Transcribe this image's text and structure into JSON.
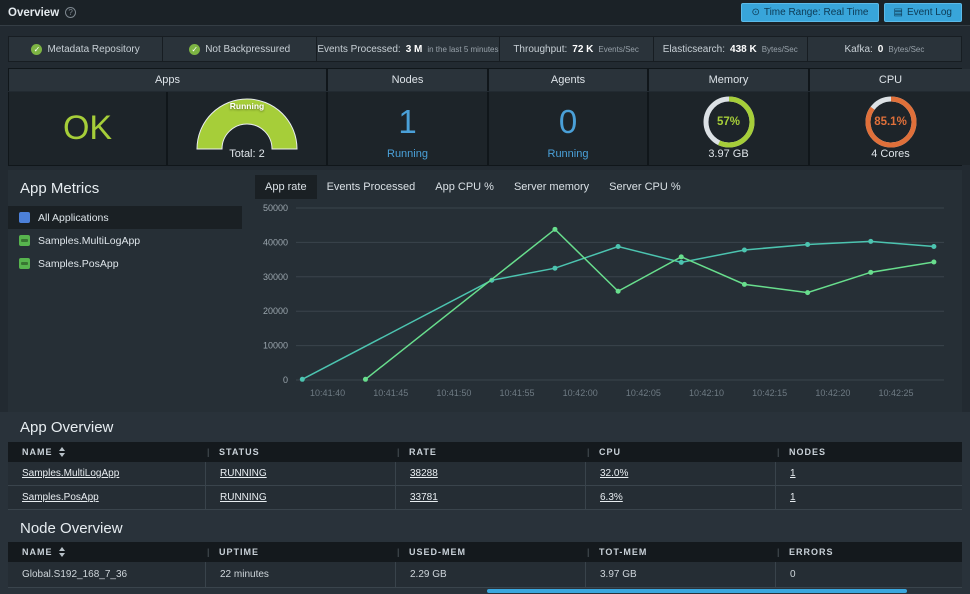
{
  "topbar": {
    "title": "Overview",
    "time_range_button": "Time Range: Real Time",
    "event_log_button": "Event Log"
  },
  "status_bar": [
    {
      "icon": "check",
      "label": "Metadata Repository",
      "value": "",
      "suffix": ""
    },
    {
      "icon": "check",
      "label": "Not Backpressured",
      "value": "",
      "suffix": ""
    },
    {
      "icon": "",
      "label": "Events Processed:",
      "value": "3 M",
      "suffix": "in the last 5 minutes"
    },
    {
      "icon": "",
      "label": "Throughput:",
      "value": "72 K",
      "suffix": "Events/Sec"
    },
    {
      "icon": "",
      "label": "Elasticsearch:",
      "value": "438 K",
      "suffix": "Bytes/Sec"
    },
    {
      "icon": "",
      "label": "Kafka:",
      "value": "0",
      "suffix": "Bytes/Sec"
    }
  ],
  "summary": {
    "headers": [
      "Apps",
      "Nodes",
      "Agents",
      "Memory",
      "CPU"
    ],
    "apps": {
      "status_text": "OK",
      "gauge_label": "Running",
      "total_label": "Total: 2",
      "gauge_color": "#a6ce39"
    },
    "nodes": {
      "value": "1",
      "sub": "Running"
    },
    "agents": {
      "value": "0",
      "sub": "Running"
    },
    "memory": {
      "percent": 57,
      "percent_label": "57%",
      "sub": "3.97 GB",
      "color": "#a6ce39"
    },
    "cpu": {
      "percent": 85.1,
      "percent_label": "85.1%",
      "sub": "4 Cores",
      "color": "#e0703a"
    }
  },
  "app_metrics": {
    "title": "App Metrics",
    "tabs": [
      {
        "label": "App rate",
        "active": true
      },
      {
        "label": "Events Processed",
        "active": false
      },
      {
        "label": "App CPU %",
        "active": false
      },
      {
        "label": "Server memory",
        "active": false
      },
      {
        "label": "Server CPU %",
        "active": false
      }
    ],
    "legend": [
      {
        "label": "All Applications",
        "color": "#4c80d8",
        "selected": true,
        "kind": "all"
      },
      {
        "label": "Samples.MultiLogApp",
        "color": "#57b44e",
        "selected": false,
        "kind": "app"
      },
      {
        "label": "Samples.PosApp",
        "color": "#57b44e",
        "selected": false,
        "kind": "app"
      }
    ]
  },
  "chart_data": {
    "type": "line",
    "title": "App rate",
    "xlabel": "",
    "ylabel": "",
    "ylim": [
      0,
      50000
    ],
    "yticks": [
      0,
      10000,
      20000,
      30000,
      40000,
      50000
    ],
    "grid": true,
    "legend_position": "left",
    "xlim_seconds": [
      37.5,
      88.8
    ],
    "xticks": [
      {
        "t": 40,
        "label": "10:41:40"
      },
      {
        "t": 45,
        "label": "10:41:45"
      },
      {
        "t": 50,
        "label": "10:41:50"
      },
      {
        "t": 55,
        "label": "10:41:55"
      },
      {
        "t": 60,
        "label": "10:42:00"
      },
      {
        "t": 65,
        "label": "10:42:05"
      },
      {
        "t": 70,
        "label": "10:42:10"
      },
      {
        "t": 75,
        "label": "10:42:15"
      },
      {
        "t": 80,
        "label": "10:42:20"
      },
      {
        "t": 85,
        "label": "10:42:25"
      }
    ],
    "series": [
      {
        "name": "Samples.MultiLogApp",
        "color": "#4cc4b0",
        "x": [
          38,
          53,
          58,
          63,
          68,
          73,
          78,
          83,
          88
        ],
        "values": [
          200,
          29000,
          32500,
          38800,
          34200,
          37800,
          39400,
          40300,
          38800
        ]
      },
      {
        "name": "Samples.PosApp",
        "color": "#68de8d",
        "x": [
          43,
          58,
          63,
          68,
          73,
          78,
          83,
          88
        ],
        "values": [
          200,
          43800,
          25800,
          35800,
          27800,
          25400,
          31300,
          34300
        ]
      }
    ]
  },
  "app_overview": {
    "title": "App Overview",
    "columns": [
      "NAME",
      "STATUS",
      "RATE",
      "CPU",
      "NODES"
    ],
    "rows": [
      [
        "Samples.MultiLogApp",
        "RUNNING",
        "38288",
        "32.0%",
        "1"
      ],
      [
        "Samples.PosApp",
        "RUNNING",
        "33781",
        "6.3%",
        "1"
      ]
    ]
  },
  "node_overview": {
    "title": "Node Overview",
    "columns": [
      "NAME",
      "UPTIME",
      "USED-MEM",
      "TOT-MEM",
      "ERRORS"
    ],
    "rows": [
      [
        "Global.S192_168_7_36",
        "22 minutes",
        "2.29 GB",
        "3.97 GB",
        "0"
      ]
    ]
  }
}
